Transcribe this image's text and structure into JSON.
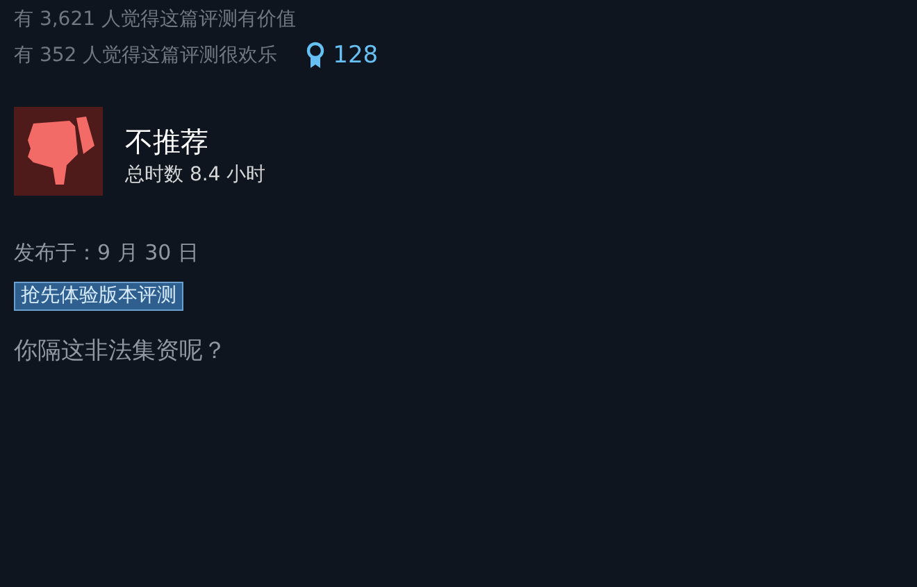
{
  "votes": [
    {
      "text": "有 3,621 人觉得这篇评测有价值"
    },
    {
      "text": "有 352 人觉得这篇评测很欢乐",
      "award_count": "128"
    }
  ],
  "review": {
    "recommended": false,
    "verdict": "不推荐",
    "playtime": "总时数 8.4 小时",
    "posted": "发布于：9 月 30 日",
    "tag": "抢先体验版本评测",
    "body": "你隔这非法集资呢？"
  }
}
